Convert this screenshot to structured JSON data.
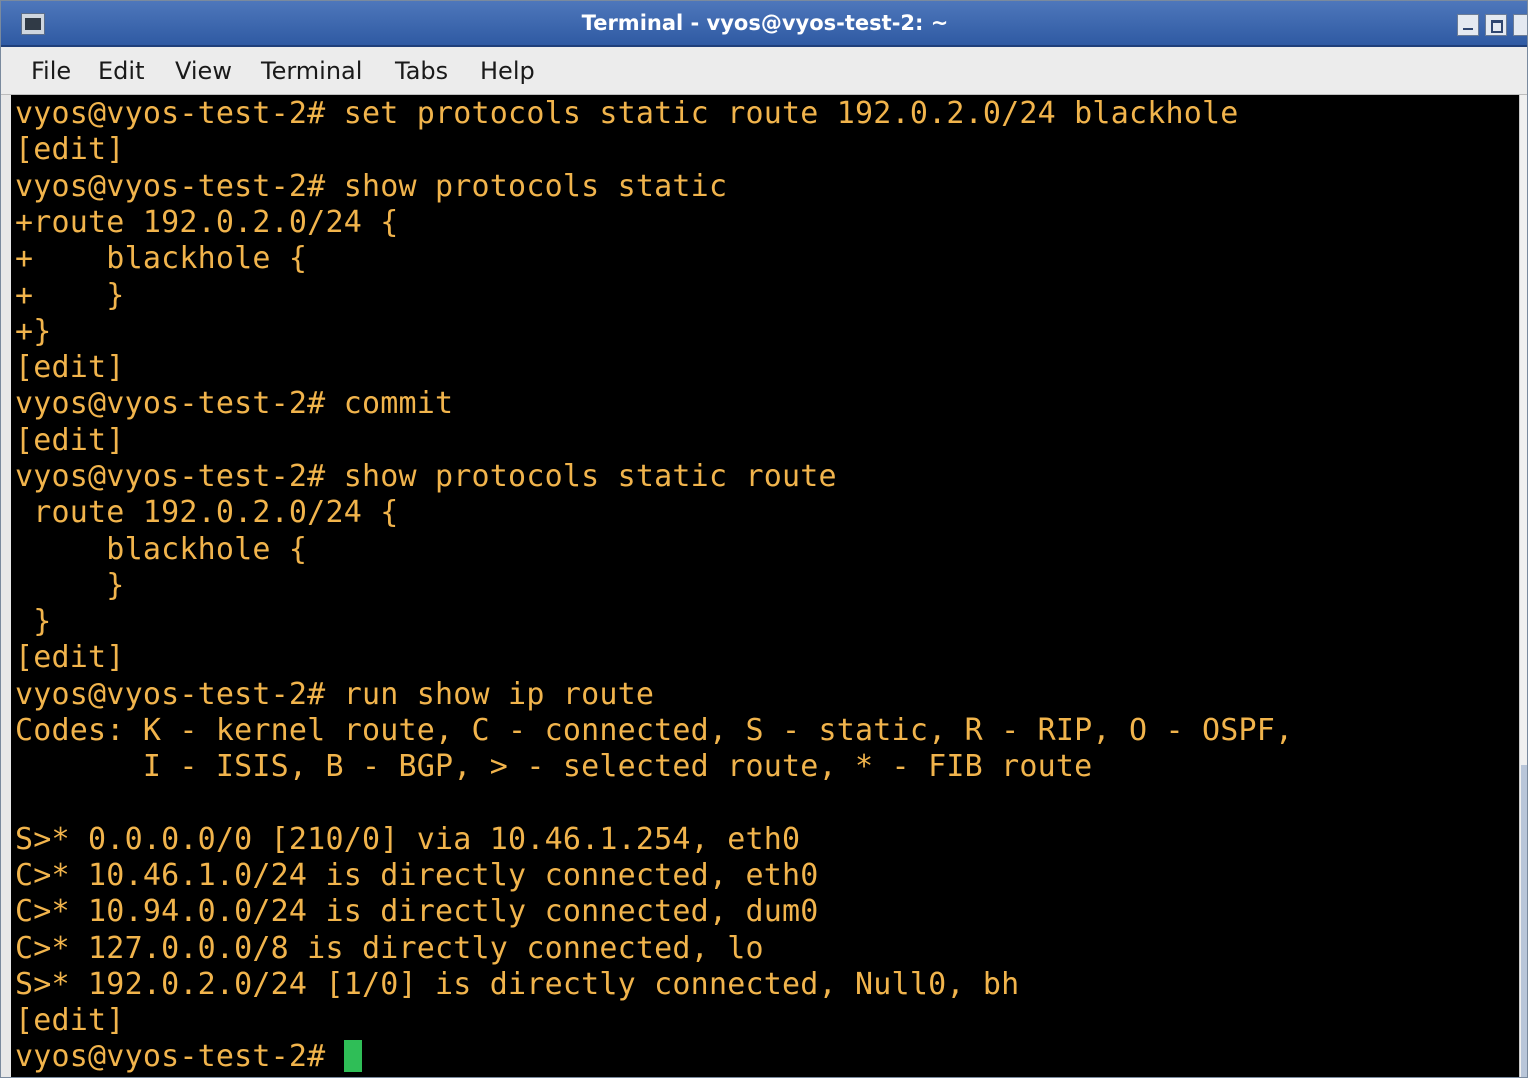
{
  "window": {
    "title": "Terminal - vyos@vyos-test-2: ~",
    "buttons": [
      "minimize",
      "maximize",
      "close"
    ]
  },
  "menu": [
    "File",
    "Edit",
    "View",
    "Terminal",
    "Tabs",
    "Help"
  ],
  "terminal": {
    "text_color": "#f1b44c",
    "background": "#000000",
    "cursor_color": "#2fbe57",
    "lines": [
      "vyos@vyos-test-2# set protocols static route 192.0.2.0/24 blackhole",
      "[edit]",
      "vyos@vyos-test-2# show protocols static",
      "+route 192.0.2.0/24 {",
      "+    blackhole {",
      "+    }",
      "+}",
      "[edit]",
      "vyos@vyos-test-2# commit",
      "[edit]",
      "vyos@vyos-test-2# show protocols static route",
      " route 192.0.2.0/24 {",
      "     blackhole {",
      "     }",
      " }",
      "[edit]",
      "vyos@vyos-test-2# run show ip route",
      "Codes: K - kernel route, C - connected, S - static, R - RIP, O - OSPF,",
      "       I - ISIS, B - BGP, > - selected route, * - FIB route",
      "",
      "S>* 0.0.0.0/0 [210/0] via 10.46.1.254, eth0",
      "C>* 10.46.1.0/24 is directly connected, eth0",
      "C>* 10.94.0.0/24 is directly connected, dum0",
      "C>* 127.0.0.0/8 is directly connected, lo",
      "S>* 192.0.2.0/24 [1/0] is directly connected, Null0, bh",
      "[edit]"
    ],
    "prompt": "vyos@vyos-test-2# "
  }
}
